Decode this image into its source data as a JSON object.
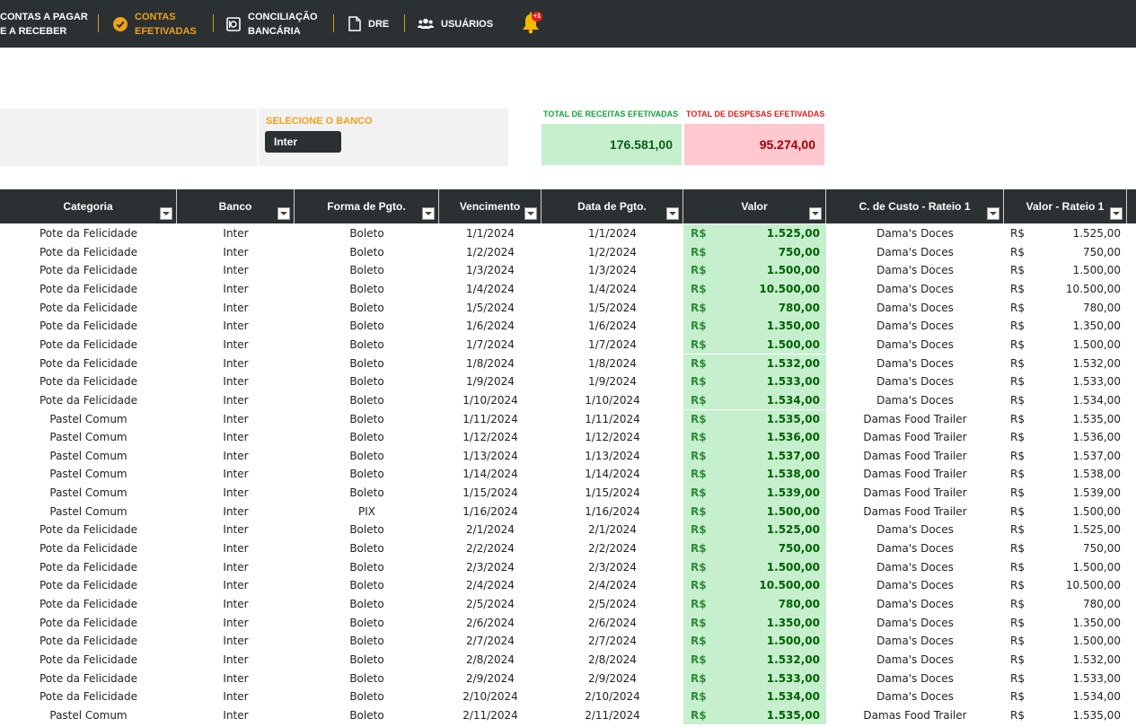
{
  "nav": {
    "contas_pagar_line1": "CONTAS A PAGAR",
    "contas_pagar_line2": "E A RECEBER",
    "efetivadas_line1": "CONTAS",
    "efetivadas_line2": "EFETIVADAS",
    "conciliacao_line1": "CONCILIAÇÃO",
    "conciliacao_line2": "BANCÁRIA",
    "dre": "DRE",
    "usuarios": "USUÁRIOS",
    "notification_badge": "+1",
    "active_color": "#f0a11a"
  },
  "bank": {
    "label": "SELECIONE O BANCO",
    "selected": "Inter"
  },
  "totals": {
    "receitas_label": "TOTAL DE RECEITAS EFETIVADAS",
    "receitas_value": "176.581,00",
    "despesas_label": "TOTAL DE DESPESAS EFETIVADAS",
    "despesas_value": "95.274,00",
    "receitas_color": "#12a33a",
    "despesas_color": "#e0201a"
  },
  "table": {
    "currency": "R$",
    "headers": [
      "Categoria",
      "Banco",
      "Forma de Pgto.",
      "Vencimento",
      "Data de Pgto.",
      "Valor",
      "C. de Custo - Rateio 1",
      "Valor - Rateio 1"
    ],
    "rows": [
      [
        "Pote da Felicidade",
        "Inter",
        "Boleto",
        "1/1/2024",
        "1/1/2024",
        "1.525,00",
        "Dama's Doces",
        "1.525,00"
      ],
      [
        "Pote da Felicidade",
        "Inter",
        "Boleto",
        "1/2/2024",
        "1/2/2024",
        "750,00",
        "Dama's Doces",
        "750,00"
      ],
      [
        "Pote da Felicidade",
        "Inter",
        "Boleto",
        "1/3/2024",
        "1/3/2024",
        "1.500,00",
        "Dama's Doces",
        "1.500,00"
      ],
      [
        "Pote da Felicidade",
        "Inter",
        "Boleto",
        "1/4/2024",
        "1/4/2024",
        "10.500,00",
        "Dama's Doces",
        "10.500,00"
      ],
      [
        "Pote da Felicidade",
        "Inter",
        "Boleto",
        "1/5/2024",
        "1/5/2024",
        "780,00",
        "Dama's Doces",
        "780,00"
      ],
      [
        "Pote da Felicidade",
        "Inter",
        "Boleto",
        "1/6/2024",
        "1/6/2024",
        "1.350,00",
        "Dama's Doces",
        "1.350,00"
      ],
      [
        "Pote da Felicidade",
        "Inter",
        "Boleto",
        "1/7/2024",
        "1/7/2024",
        "1.500,00",
        "Dama's Doces",
        "1.500,00"
      ],
      [
        "Pote da Felicidade",
        "Inter",
        "Boleto",
        "1/8/2024",
        "1/8/2024",
        "1.532,00",
        "Dama's Doces",
        "1.532,00"
      ],
      [
        "Pote da Felicidade",
        "Inter",
        "Boleto",
        "1/9/2024",
        "1/9/2024",
        "1.533,00",
        "Dama's Doces",
        "1.533,00"
      ],
      [
        "Pote da Felicidade",
        "Inter",
        "Boleto",
        "1/10/2024",
        "1/10/2024",
        "1.534,00",
        "Dama's Doces",
        "1.534,00"
      ],
      [
        "Pastel Comum",
        "Inter",
        "Boleto",
        "1/11/2024",
        "1/11/2024",
        "1.535,00",
        "Damas Food Trailer",
        "1.535,00"
      ],
      [
        "Pastel Comum",
        "Inter",
        "Boleto",
        "1/12/2024",
        "1/12/2024",
        "1.536,00",
        "Damas Food Trailer",
        "1.536,00"
      ],
      [
        "Pastel Comum",
        "Inter",
        "Boleto",
        "1/13/2024",
        "1/13/2024",
        "1.537,00",
        "Damas Food Trailer",
        "1.537,00"
      ],
      [
        "Pastel Comum",
        "Inter",
        "Boleto",
        "1/14/2024",
        "1/14/2024",
        "1.538,00",
        "Damas Food Trailer",
        "1.538,00"
      ],
      [
        "Pastel Comum",
        "Inter",
        "Boleto",
        "1/15/2024",
        "1/15/2024",
        "1.539,00",
        "Damas Food Trailer",
        "1.539,00"
      ],
      [
        "Pastel Comum",
        "Inter",
        "PIX",
        "1/16/2024",
        "1/16/2024",
        "1.500,00",
        "Damas Food Trailer",
        "1.500,00"
      ],
      [
        "Pote da Felicidade",
        "Inter",
        "Boleto",
        "2/1/2024",
        "2/1/2024",
        "1.525,00",
        "Dama's Doces",
        "1.525,00"
      ],
      [
        "Pote da Felicidade",
        "Inter",
        "Boleto",
        "2/2/2024",
        "2/2/2024",
        "750,00",
        "Dama's Doces",
        "750,00"
      ],
      [
        "Pote da Felicidade",
        "Inter",
        "Boleto",
        "2/3/2024",
        "2/3/2024",
        "1.500,00",
        "Dama's Doces",
        "1.500,00"
      ],
      [
        "Pote da Felicidade",
        "Inter",
        "Boleto",
        "2/4/2024",
        "2/4/2024",
        "10.500,00",
        "Dama's Doces",
        "10.500,00"
      ],
      [
        "Pote da Felicidade",
        "Inter",
        "Boleto",
        "2/5/2024",
        "2/5/2024",
        "780,00",
        "Dama's Doces",
        "780,00"
      ],
      [
        "Pote da Felicidade",
        "Inter",
        "Boleto",
        "2/6/2024",
        "2/6/2024",
        "1.350,00",
        "Dama's Doces",
        "1.350,00"
      ],
      [
        "Pote da Felicidade",
        "Inter",
        "Boleto",
        "2/7/2024",
        "2/7/2024",
        "1.500,00",
        "Dama's Doces",
        "1.500,00"
      ],
      [
        "Pote da Felicidade",
        "Inter",
        "Boleto",
        "2/8/2024",
        "2/8/2024",
        "1.532,00",
        "Dama's Doces",
        "1.532,00"
      ],
      [
        "Pote da Felicidade",
        "Inter",
        "Boleto",
        "2/9/2024",
        "2/9/2024",
        "1.533,00",
        "Dama's Doces",
        "1.533,00"
      ],
      [
        "Pote da Felicidade",
        "Inter",
        "Boleto",
        "2/10/2024",
        "2/10/2024",
        "1.534,00",
        "Dama's Doces",
        "1.534,00"
      ],
      [
        "Pastel Comum",
        "Inter",
        "Boleto",
        "2/11/2024",
        "2/11/2024",
        "1.535,00",
        "Damas Food Trailer",
        "1.535,00"
      ]
    ]
  }
}
